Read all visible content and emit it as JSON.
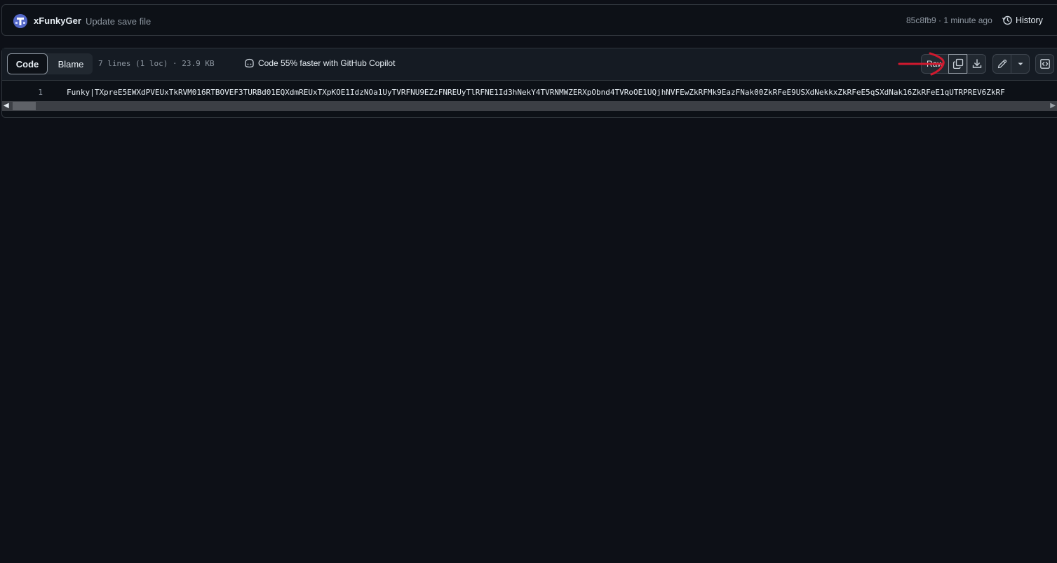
{
  "commit": {
    "author": "xFunkyGer",
    "message": "Update save file",
    "meta": "85c8fb9 · 1 minute ago",
    "history_label": "History"
  },
  "file": {
    "tabs": {
      "code": "Code",
      "blame": "Blame"
    },
    "info": "7 lines (1 loc) · 23.9 KB",
    "copilot_text": "Code 55% faster with GitHub Copilot",
    "toolbar": {
      "raw_label": "Raw",
      "icons": [
        "copy-icon",
        "download-icon",
        "pencil-icon",
        "triangle-down-icon",
        "code-square-icon"
      ]
    },
    "lines": [
      {
        "number": "1",
        "text": "Funky|TXpreE5EWXdPVEUxTkRVM016RTBOVEF3TURBd01EQXdmREUxTXpKOE1IdzNOa1UyTVRFNU9EZzFNREUyTlRFNE1Id3hNekY4TVRNMWZERXpObnd4TVRoOE1UQjhNVFEwZkRFMk9EazFNak00ZkRFeE9USXdNekkxZkRFeE5qSXdNak16ZkRFeE1qUTRPREV6ZkRF"
      }
    ]
  },
  "colors": {
    "background": "#0d1017",
    "header": "#151b23",
    "border": "#30363d",
    "text": "#e6edf3",
    "muted": "#8d96a0",
    "annotation_arrow": "#d1192e"
  }
}
